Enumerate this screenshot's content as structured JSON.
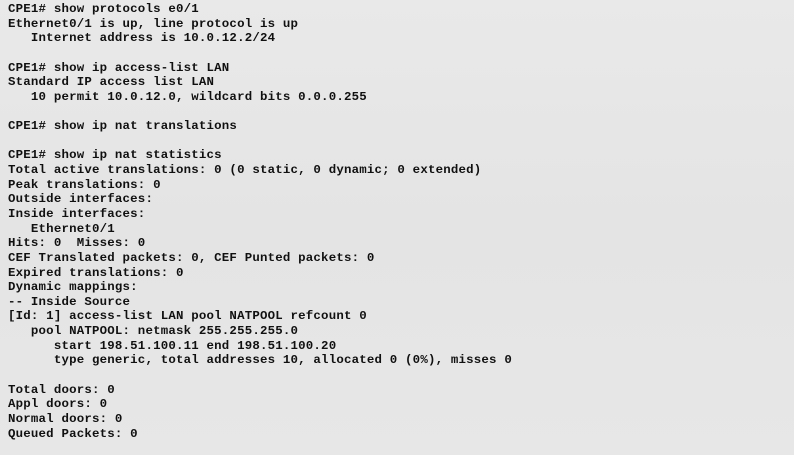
{
  "terminal": {
    "lines": [
      "CPE1# show protocols e0/1",
      "Ethernet0/1 is up, line protocol is up",
      "   Internet address is 10.0.12.2/24",
      "",
      "CPE1# show ip access-list LAN",
      "Standard IP access list LAN",
      "   10 permit 10.0.12.0, wildcard bits 0.0.0.255",
      "",
      "CPE1# show ip nat translations",
      "",
      "CPE1# show ip nat statistics",
      "Total active translations: 0 (0 static, 0 dynamic; 0 extended)",
      "Peak translations: 0",
      "Outside interfaces:",
      "Inside interfaces:",
      "   Ethernet0/1",
      "Hits: 0  Misses: 0",
      "CEF Translated packets: 0, CEF Punted packets: 0",
      "Expired translations: 0",
      "Dynamic mappings:",
      "-- Inside Source",
      "[Id: 1] access-list LAN pool NATPOOL refcount 0",
      "   pool NATPOOL: netmask 255.255.255.0",
      "      start 198.51.100.11 end 198.51.100.20",
      "      type generic, total addresses 10, allocated 0 (0%), misses 0",
      "",
      "Total doors: 0",
      "Appl doors: 0",
      "Normal doors: 0",
      "Queued Packets: 0"
    ]
  }
}
